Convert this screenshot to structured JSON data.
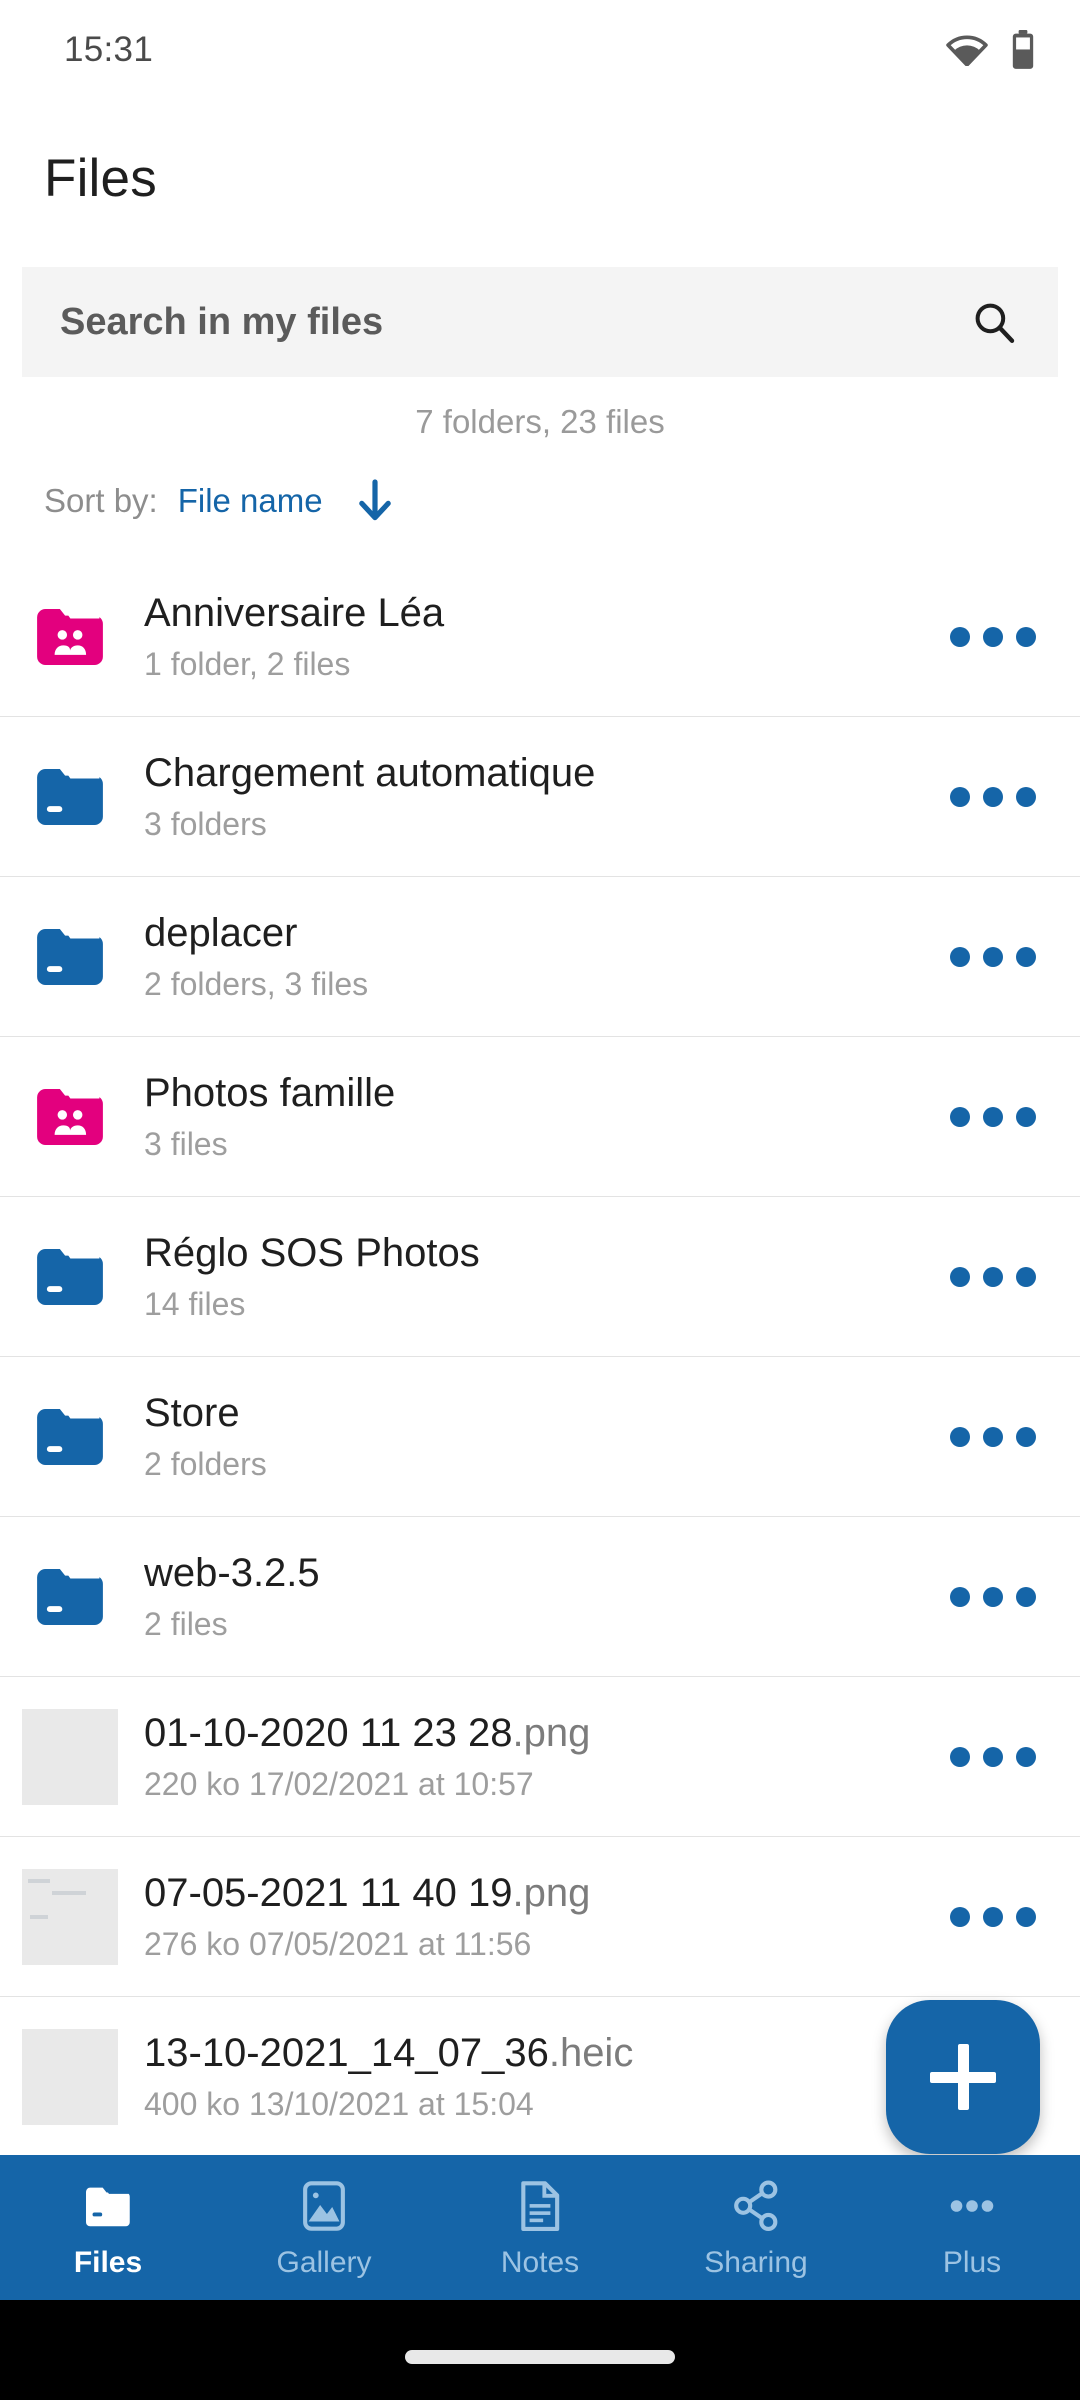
{
  "status_bar": {
    "time": "15:31",
    "wifi_icon": "wifi-icon",
    "battery_icon": "battery-icon"
  },
  "header": {
    "title": "Files"
  },
  "search": {
    "placeholder": "Search in my files",
    "icon": "search-icon"
  },
  "summary": {
    "counts": "7 folders, 23 files"
  },
  "sort": {
    "label": "Sort by:",
    "value": "File name",
    "direction_icon": "arrow-down-icon"
  },
  "colors": {
    "primary_blue": "#1565a8",
    "shared_pink": "#e3007e",
    "nav_inactive": "#9cc3e3",
    "search_bg": "#f4f4f4",
    "subtitle_gray": "#9e9e9e"
  },
  "list": {
    "more_icon": "more-options-icon",
    "items": [
      {
        "name": "Anniversaire Léa",
        "meta": "1 folder, 2 files",
        "icon": "shared-folder-icon",
        "kind": "folder-shared"
      },
      {
        "name": "Chargement automatique",
        "meta": "3 folders",
        "icon": "folder-icon",
        "kind": "folder"
      },
      {
        "name": "deplacer",
        "meta": "2 folders, 3 files",
        "icon": "folder-icon",
        "kind": "folder"
      },
      {
        "name": "Photos famille",
        "meta": "3 files",
        "icon": "shared-folder-icon",
        "kind": "folder-shared"
      },
      {
        "name": "Réglo SOS Photos",
        "meta": "14 files",
        "icon": "folder-icon",
        "kind": "folder"
      },
      {
        "name": "Store",
        "meta": "2 folders",
        "icon": "folder-icon",
        "kind": "folder"
      },
      {
        "name": "web-3.2.5",
        "meta": "2 files",
        "icon": "folder-icon",
        "kind": "folder"
      },
      {
        "name": "01-10-2020 11 23 28",
        "extension": ".png",
        "meta": "220 ko 17/02/2021 at 10:57",
        "icon": "image-thumbnail",
        "kind": "file-image",
        "thumb": "screenshot-blue-header"
      },
      {
        "name": "07-05-2021 11 40 19",
        "extension": ".png",
        "meta": "276 ko 07/05/2021 at 11:56",
        "icon": "image-thumbnail",
        "kind": "file-image",
        "thumb": "screenshot-light"
      },
      {
        "name": "13-10-2021_14_07_36",
        "extension": ".heic",
        "meta": "400 ko 13/10/2021 at 15:04",
        "icon": "image-thumbnail",
        "kind": "file-image",
        "thumb": "photo-pen"
      }
    ]
  },
  "fab": {
    "label": "+",
    "icon": "plus-icon"
  },
  "bottom_nav": {
    "items": [
      {
        "label": "Files",
        "icon": "files-icon",
        "active": true
      },
      {
        "label": "Gallery",
        "icon": "gallery-icon",
        "active": false
      },
      {
        "label": "Notes",
        "icon": "notes-icon",
        "active": false
      },
      {
        "label": "Sharing",
        "icon": "sharing-icon",
        "active": false
      },
      {
        "label": "Plus",
        "icon": "plus-dots-icon",
        "active": false
      }
    ]
  }
}
